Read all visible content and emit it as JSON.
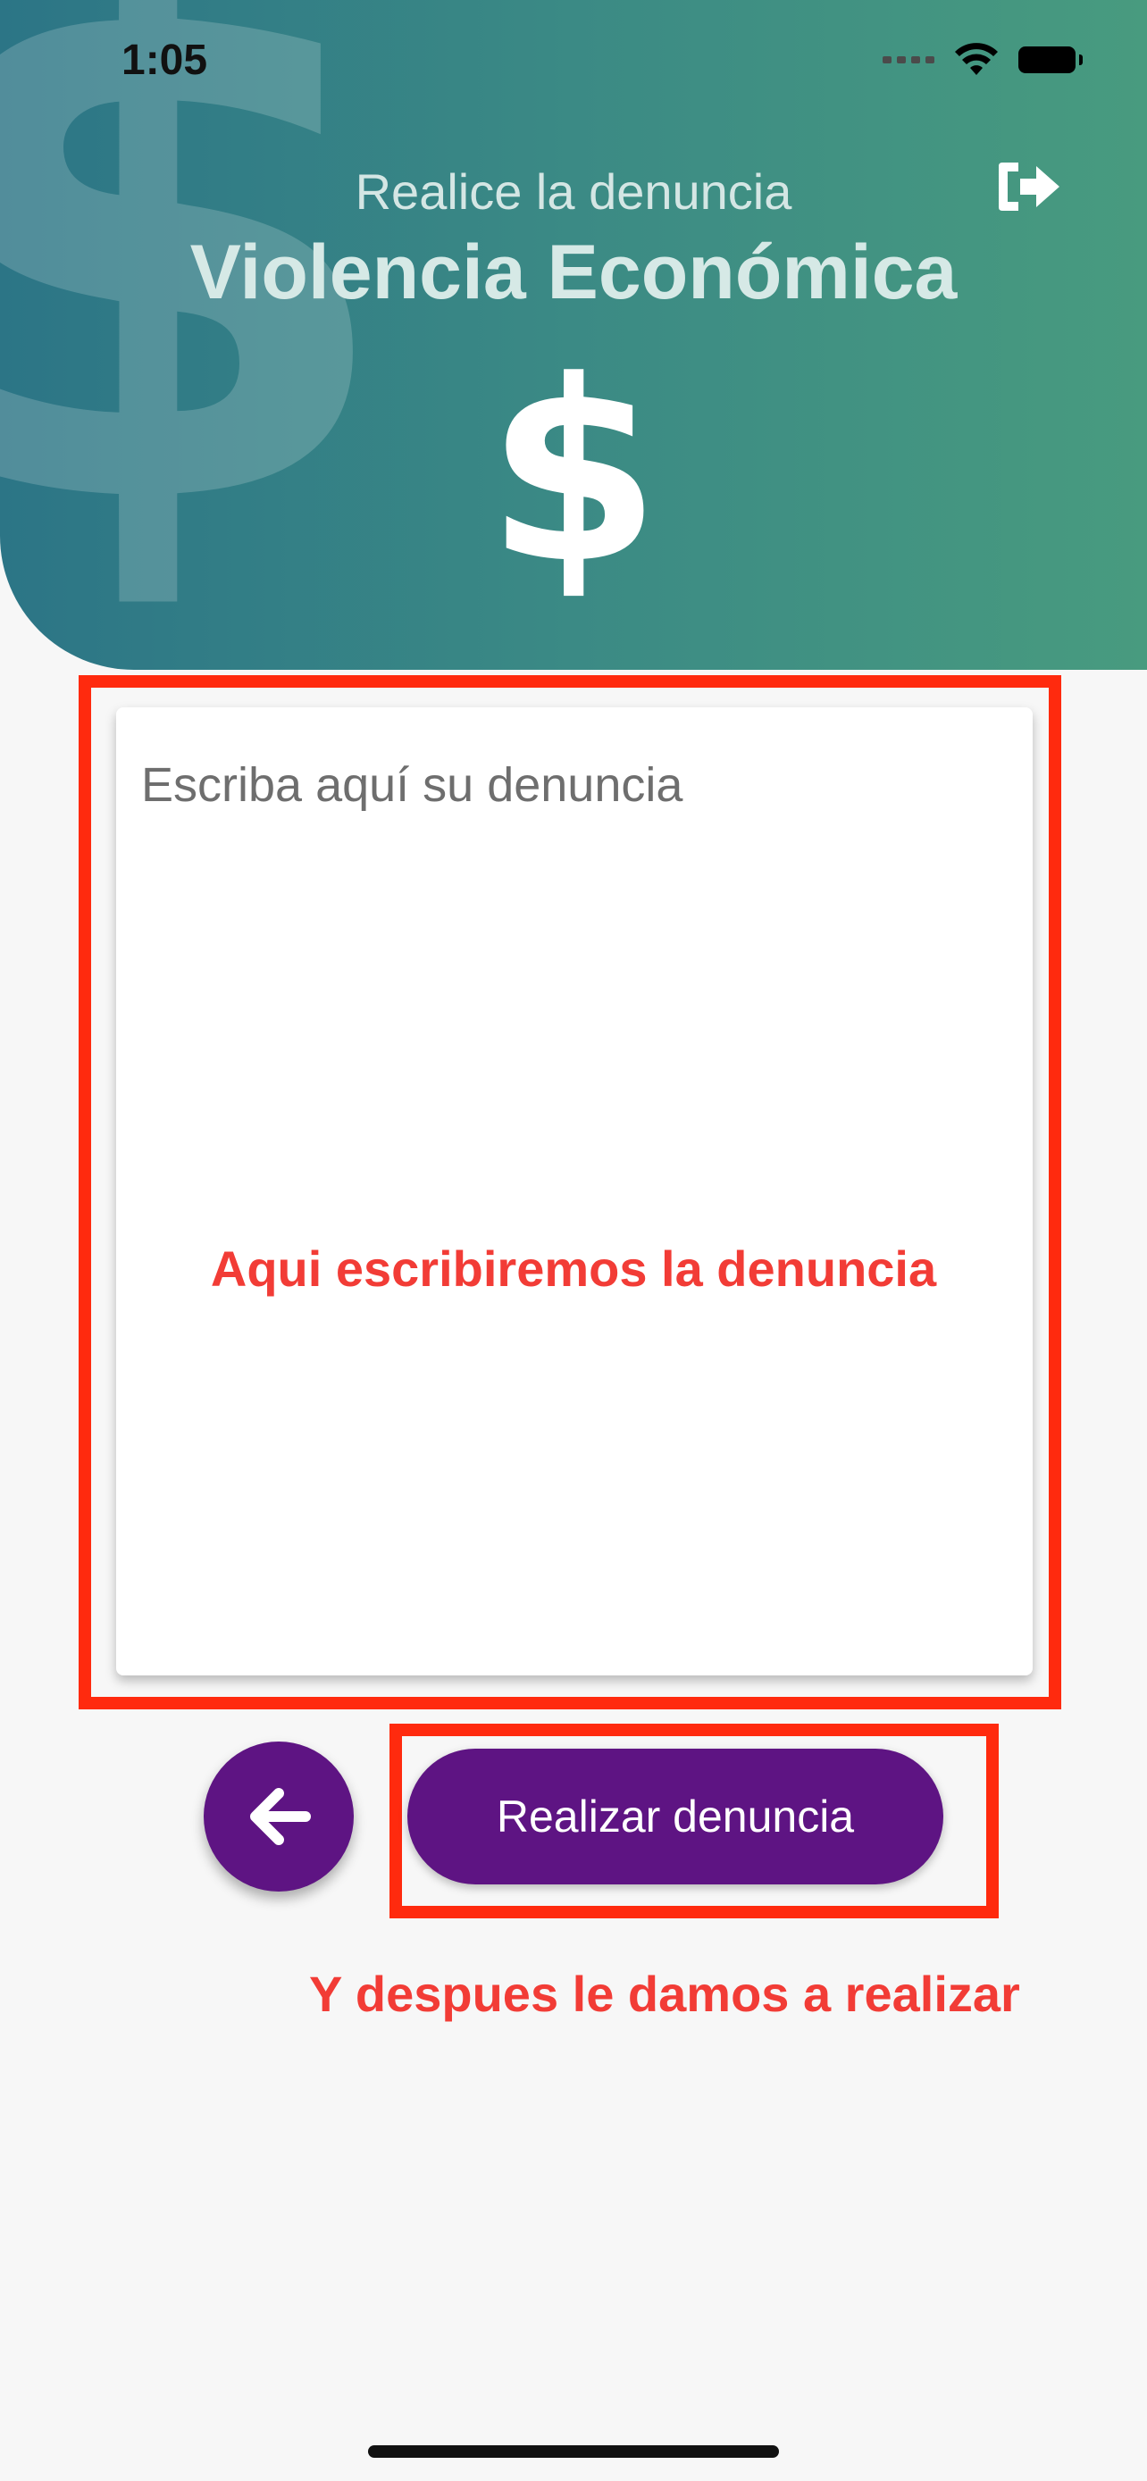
{
  "status_bar": {
    "time": "1:05"
  },
  "header": {
    "subtitle": "Realice la denuncia",
    "title": "Violencia Económica",
    "symbol": "$",
    "logout_icon": "logout-icon"
  },
  "form": {
    "placeholder": "Escriba aquí su denuncia",
    "submit_label": "Realizar denuncia",
    "back_icon": "arrow-left-icon"
  },
  "annotations": {
    "textarea_note": "Aqui escribiremos la denuncia",
    "submit_note": "Y despues le damos a realizar"
  },
  "colors": {
    "header_gradient_start": "#2c7586",
    "header_gradient_end": "#489b7f",
    "primary": "#5e1483",
    "annotation": "#ff2a0e"
  }
}
